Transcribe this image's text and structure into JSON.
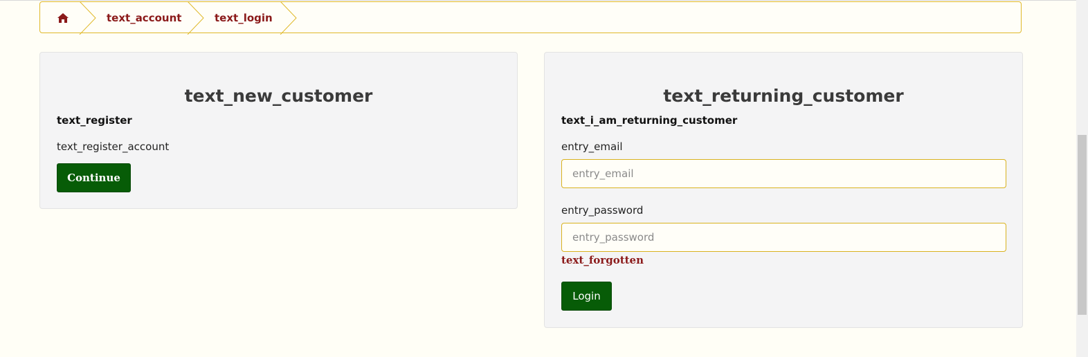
{
  "breadcrumb": {
    "items": [
      {
        "label": "",
        "icon": "home-icon"
      },
      {
        "label": "text_account"
      },
      {
        "label": "text_login"
      }
    ]
  },
  "new_customer": {
    "title": "text_new_customer",
    "subheading": "text_register",
    "description": "text_register_account",
    "continue_label": "Continue"
  },
  "returning_customer": {
    "title": "text_returning_customer",
    "subheading": "text_i_am_returning_customer",
    "email_label": "entry_email",
    "email_placeholder": "entry_email",
    "email_value": "",
    "password_label": "entry_password",
    "password_placeholder": "entry_password",
    "password_value": "",
    "forgotten_link": "text_forgotten",
    "login_label": "Login"
  },
  "colors": {
    "accent_border": "#e0b92a",
    "link": "#8b1a1a",
    "button": "#075c07",
    "background": "#fffef6",
    "panel": "#f4f4f5"
  }
}
